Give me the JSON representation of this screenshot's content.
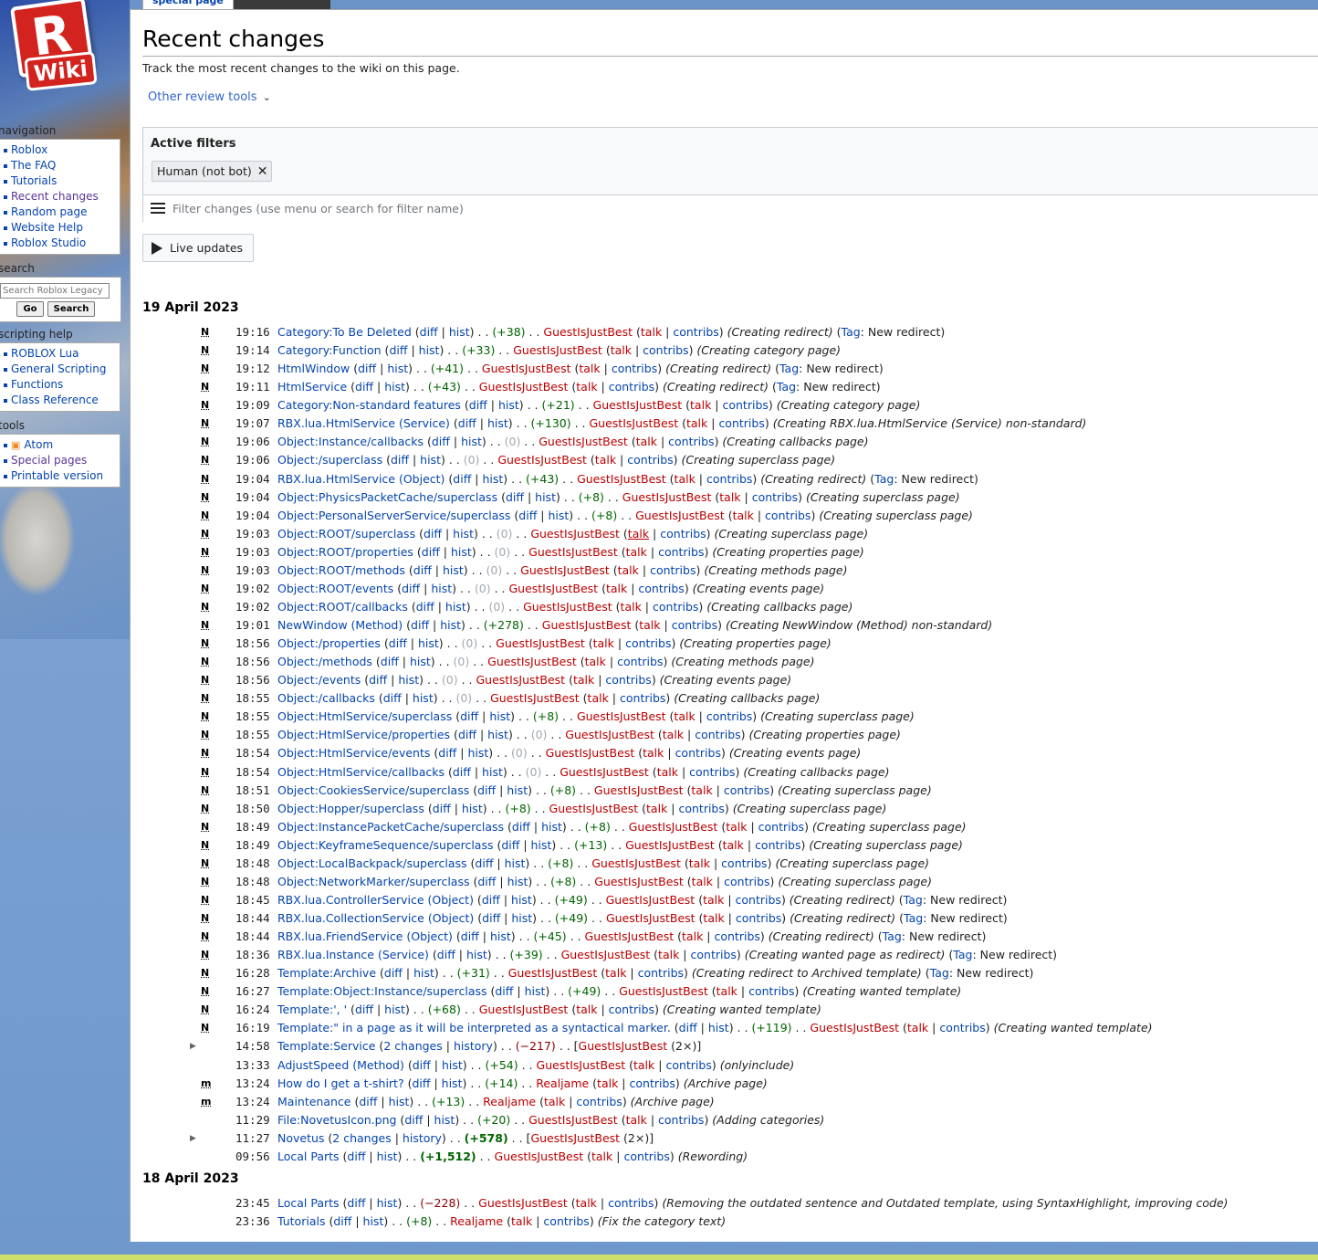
{
  "tab": {
    "label": "special page"
  },
  "logo": {
    "letter": "R",
    "text": "Wiki"
  },
  "sidebar": {
    "navigation": {
      "heading": "navigation",
      "items": [
        "Roblox",
        "The FAQ",
        "Tutorials",
        "Recent changes",
        "Random page",
        "Website Help",
        "Roblox Studio"
      ]
    },
    "search": {
      "heading": "search",
      "placeholder": "Search Roblox Legacy",
      "go": "Go",
      "search": "Search"
    },
    "scripting": {
      "heading": "scripting help",
      "items": [
        "ROBLOX Lua",
        "General Scripting",
        "Functions",
        "Class Reference"
      ]
    },
    "tools": {
      "heading": "tools",
      "items": [
        "Atom",
        "Special pages",
        "Printable version"
      ]
    }
  },
  "page": {
    "title": "Recent changes",
    "intro": "Track the most recent changes to the wiki on this page.",
    "review_tools": "Other review tools",
    "active_filters": "Active filters",
    "filter_chip": "Human (not bot)",
    "filter_placeholder": "Filter changes (use menu or search for filter name)",
    "live_updates": "Live updates"
  },
  "days": [
    {
      "date": "19 April 2023",
      "rows": [
        {
          "f": "N",
          "t": "19:16",
          "p": "Category:To Be Deleted",
          "d": "+38",
          "u": "GuestIsJustBest",
          "c": "Creating redirect",
          "tag": "New redirect"
        },
        {
          "f": "N",
          "t": "19:14",
          "p": "Category:Function",
          "d": "+33",
          "u": "GuestIsJustBest",
          "c": "Creating category page"
        },
        {
          "f": "N",
          "t": "19:12",
          "p": "HtmlWindow",
          "d": "+41",
          "u": "GuestIsJustBest",
          "c": "Creating redirect",
          "tag": "New redirect"
        },
        {
          "f": "N",
          "t": "19:11",
          "p": "HtmlService",
          "d": "+43",
          "u": "GuestIsJustBest",
          "c": "Creating redirect",
          "tag": "New redirect"
        },
        {
          "f": "N",
          "t": "19:09",
          "p": "Category:Non-standard features",
          "d": "+21",
          "u": "GuestIsJustBest",
          "c": "Creating category page"
        },
        {
          "f": "N",
          "t": "19:07",
          "p": "RBX.lua.HtmlService (Service)",
          "d": "+130",
          "u": "GuestIsJustBest",
          "c": "Creating RBX.lua.HtmlService (Service) non-standard"
        },
        {
          "f": "N",
          "t": "19:06",
          "p": "Object:Instance/callbacks",
          "d": "0",
          "u": "GuestIsJustBest",
          "c": "Creating callbacks page"
        },
        {
          "f": "N",
          "t": "19:06",
          "p": "Object:/superclass",
          "d": "0",
          "u": "GuestIsJustBest",
          "c": "Creating superclass page"
        },
        {
          "f": "N",
          "t": "19:04",
          "p": "RBX.lua.HtmlService (Object)",
          "d": "+43",
          "u": "GuestIsJustBest",
          "c": "Creating redirect",
          "tag": "New redirect"
        },
        {
          "f": "N",
          "t": "19:04",
          "p": "Object:PhysicsPacketCache/superclass",
          "d": "+8",
          "u": "GuestIsJustBest",
          "c": "Creating superclass page"
        },
        {
          "f": "N",
          "t": "19:04",
          "p": "Object:PersonalServerService/superclass",
          "d": "+8",
          "u": "GuestIsJustBest",
          "c": "Creating superclass page"
        },
        {
          "f": "N",
          "t": "19:03",
          "p": "Object:ROOT/superclass",
          "d": "0",
          "u": "GuestIsJustBest",
          "c": "Creating superclass page",
          "talku": true
        },
        {
          "f": "N",
          "t": "19:03",
          "p": "Object:ROOT/properties",
          "d": "0",
          "u": "GuestIsJustBest",
          "c": "Creating properties page"
        },
        {
          "f": "N",
          "t": "19:03",
          "p": "Object:ROOT/methods",
          "d": "0",
          "u": "GuestIsJustBest",
          "c": "Creating methods page"
        },
        {
          "f": "N",
          "t": "19:02",
          "p": "Object:ROOT/events",
          "d": "0",
          "u": "GuestIsJustBest",
          "c": "Creating events page"
        },
        {
          "f": "N",
          "t": "19:02",
          "p": "Object:ROOT/callbacks",
          "d": "0",
          "u": "GuestIsJustBest",
          "c": "Creating callbacks page"
        },
        {
          "f": "N",
          "t": "19:01",
          "p": "NewWindow (Method)",
          "d": "+278",
          "u": "GuestIsJustBest",
          "c": "Creating NewWindow (Method) non-standard"
        },
        {
          "f": "N",
          "t": "18:56",
          "p": "Object:/properties",
          "d": "0",
          "u": "GuestIsJustBest",
          "c": "Creating properties page"
        },
        {
          "f": "N",
          "t": "18:56",
          "p": "Object:/methods",
          "d": "0",
          "u": "GuestIsJustBest",
          "c": "Creating methods page"
        },
        {
          "f": "N",
          "t": "18:56",
          "p": "Object:/events",
          "d": "0",
          "u": "GuestIsJustBest",
          "c": "Creating events page"
        },
        {
          "f": "N",
          "t": "18:55",
          "p": "Object:/callbacks",
          "d": "0",
          "u": "GuestIsJustBest",
          "c": "Creating callbacks page"
        },
        {
          "f": "N",
          "t": "18:55",
          "p": "Object:HtmlService/superclass",
          "d": "+8",
          "u": "GuestIsJustBest",
          "c": "Creating superclass page"
        },
        {
          "f": "N",
          "t": "18:55",
          "p": "Object:HtmlService/properties",
          "d": "0",
          "u": "GuestIsJustBest",
          "c": "Creating properties page"
        },
        {
          "f": "N",
          "t": "18:54",
          "p": "Object:HtmlService/events",
          "d": "0",
          "u": "GuestIsJustBest",
          "c": "Creating events page"
        },
        {
          "f": "N",
          "t": "18:54",
          "p": "Object:HtmlService/callbacks",
          "d": "0",
          "u": "GuestIsJustBest",
          "c": "Creating callbacks page"
        },
        {
          "f": "N",
          "t": "18:51",
          "p": "Object:CookiesService/superclass",
          "d": "+8",
          "u": "GuestIsJustBest",
          "c": "Creating superclass page"
        },
        {
          "f": "N",
          "t": "18:50",
          "p": "Object:Hopper/superclass",
          "d": "+8",
          "u": "GuestIsJustBest",
          "c": "Creating superclass page"
        },
        {
          "f": "N",
          "t": "18:49",
          "p": "Object:InstancePacketCache/superclass",
          "d": "+8",
          "u": "GuestIsJustBest",
          "c": "Creating superclass page"
        },
        {
          "f": "N",
          "t": "18:49",
          "p": "Object:KeyframeSequence/superclass",
          "d": "+13",
          "u": "GuestIsJustBest",
          "c": "Creating superclass page"
        },
        {
          "f": "N",
          "t": "18:48",
          "p": "Object:LocalBackpack/superclass",
          "d": "+8",
          "u": "GuestIsJustBest",
          "c": "Creating superclass page"
        },
        {
          "f": "N",
          "t": "18:48",
          "p": "Object:NetworkMarker/superclass",
          "d": "+8",
          "u": "GuestIsJustBest",
          "c": "Creating superclass page"
        },
        {
          "f": "N",
          "t": "18:45",
          "p": "RBX.lua.ControllerService (Object)",
          "d": "+49",
          "u": "GuestIsJustBest",
          "c": "Creating redirect",
          "tag": "New redirect"
        },
        {
          "f": "N",
          "t": "18:44",
          "p": "RBX.lua.CollectionService (Object)",
          "d": "+49",
          "u": "GuestIsJustBest",
          "c": "Creating redirect",
          "tag": "New redirect"
        },
        {
          "f": "N",
          "t": "18:44",
          "p": "RBX.lua.FriendService (Object)",
          "d": "+45",
          "u": "GuestIsJustBest",
          "c": "Creating redirect",
          "tag": "New redirect"
        },
        {
          "f": "N",
          "t": "18:36",
          "p": "RBX.lua.Instance (Service)",
          "d": "+39",
          "u": "GuestIsJustBest",
          "c": "Creating wanted page as redirect",
          "tag": "New redirect"
        },
        {
          "f": "N",
          "t": "16:28",
          "p": "Template:Archive",
          "d": "+31",
          "u": "GuestIsJustBest",
          "c": "Creating redirect to Archived template",
          "tag": "New redirect"
        },
        {
          "f": "N",
          "t": "16:27",
          "p": "Template:Object:Instance/superclass",
          "d": "+49",
          "u": "GuestIsJustBest",
          "c": "Creating wanted template"
        },
        {
          "f": "N",
          "t": "16:24",
          "p": "Template:', '",
          "d": "+68",
          "u": "GuestIsJustBest",
          "c": "Creating wanted template"
        },
        {
          "f": "N",
          "t": "16:19",
          "p": "Template:\" in a page as it will be interpreted as a syntactical marker.",
          "d": "+119",
          "u": "GuestIsJustBest",
          "c": "Creating wanted template"
        },
        {
          "f": "",
          "grp": true,
          "t": "14:58",
          "p": "Template:Service",
          "changes": "2 changes",
          "d": "−217",
          "u": "GuestIsJustBest",
          "n": "2×"
        },
        {
          "f": "",
          "t": "13:33",
          "p": "AdjustSpeed (Method)",
          "d": "+54",
          "u": "GuestIsJustBest",
          "c": "onlyinclude"
        },
        {
          "f": "m",
          "t": "13:24",
          "p": "How do I get a t-shirt?",
          "d": "+14",
          "u": "Realjame",
          "c": "Archive page"
        },
        {
          "f": "m",
          "t": "13:24",
          "p": "Maintenance",
          "d": "+13",
          "u": "Realjame",
          "c": "Archive page"
        },
        {
          "f": "",
          "t": "11:29",
          "p": "File:NovetusIcon.png",
          "d": "+20",
          "u": "GuestIsJustBest",
          "c": "Adding categories"
        },
        {
          "f": "",
          "grp": true,
          "t": "11:27",
          "p": "Novetus",
          "changes": "2 changes",
          "d": "+578",
          "strong": true,
          "u": "GuestIsJustBest",
          "n": "2×"
        },
        {
          "f": "",
          "t": "09:56",
          "p": "Local Parts",
          "d": "+1,512",
          "strong": true,
          "u": "GuestIsJustBest",
          "c": "Rewording"
        }
      ]
    },
    {
      "date": "18 April 2023",
      "rows": [
        {
          "f": "",
          "t": "23:45",
          "p": "Local Parts",
          "d": "−228",
          "u": "GuestIsJustBest",
          "c": "Removing the outdated sentence and Outdated template, using SyntaxHighlight, improving code"
        },
        {
          "f": "",
          "t": "23:36",
          "p": "Tutorials",
          "d": "+8",
          "u": "Realjame",
          "c": "Fix the category text"
        }
      ]
    }
  ],
  "strings": {
    "diff": "diff",
    "hist": "hist",
    "history": "history",
    "talk": "talk",
    "contribs": "contribs",
    "tag": "Tag"
  }
}
